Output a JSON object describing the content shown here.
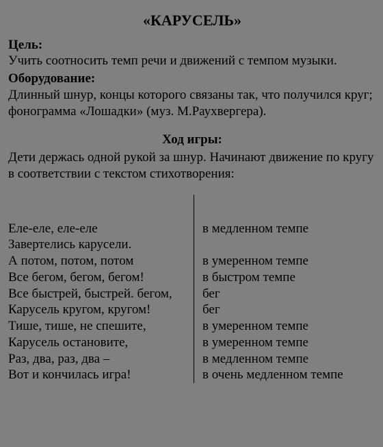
{
  "title": "«КАРУСЕЛЬ»",
  "goal_label": "Цель:",
  "goal_text": "Учить соотносить темп речи и движений с темпом музыки.",
  "equipment_label": "Оборудование:",
  "equipment_text": "Длинный шнур, концы которого связаны так, что получился круг; фонограмма «Лошадки» (муз. М.Раухвергера).",
  "gameplay_label": "Ход игры:",
  "gameplay_intro": "Дети держась одной рукой за шнур. Начинают движение по кругу в соответствии с текстом стихотворения:",
  "rows": [
    {
      "left": "Еле-еле, еле-еле",
      "right": "в медленном темпе"
    },
    {
      "left": "Завертелись карусели.",
      "right": ""
    },
    {
      "left": "А потом, потом, потом",
      "right": "в умеренном темпе"
    },
    {
      "left": "Все бегом, бегом, бегом!",
      "right": "в быстром темпе"
    },
    {
      "left": "Все быстрей, быстрей. бегом,",
      "right": "бег"
    },
    {
      "left": "Карусель кругом, кругом!",
      "right": "бег"
    },
    {
      "left": "Тише, тише, не спешите,",
      "right": "в умеренном темпе"
    },
    {
      "left": "Карусель остановите,",
      "right": "в умеренном темпе"
    },
    {
      "left": "Раз, два, раз, два –",
      "right": "в медленном темпе"
    },
    {
      "left": "Вот и кончилась игра!",
      "right": "в очень медленном темпе"
    }
  ]
}
